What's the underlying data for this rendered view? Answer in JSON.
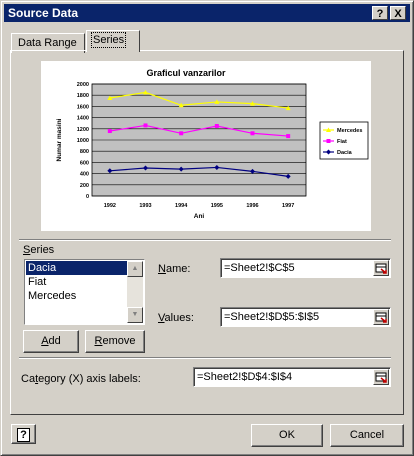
{
  "window": {
    "title": "Source Data",
    "help_glyph": "?",
    "close_glyph": "X"
  },
  "tabs": [
    {
      "label": "Data Range"
    },
    {
      "label": "Series"
    }
  ],
  "chart_data": {
    "type": "line",
    "title": "Graficul vanzarilor",
    "xlabel": "Ani",
    "ylabel": "Numar masini",
    "categories": [
      "1992",
      "1993",
      "1994",
      "1995",
      "1996",
      "1997"
    ],
    "y_ticks": [
      "0",
      "200",
      "400",
      "600",
      "800",
      "1000",
      "1200",
      "1400",
      "1600",
      "1800",
      "2000"
    ],
    "ylim": [
      0,
      2000
    ],
    "grid": true,
    "legend_position": "right",
    "series": [
      {
        "name": "Mercedes",
        "color": "#ffff00",
        "marker": "triangle",
        "values": [
          1750,
          1850,
          1620,
          1680,
          1650,
          1570
        ]
      },
      {
        "name": "Fiat",
        "color": "#ff00ff",
        "marker": "square",
        "values": [
          1160,
          1260,
          1120,
          1250,
          1120,
          1070
        ]
      },
      {
        "name": "Dacia",
        "color": "#000080",
        "marker": "diamond",
        "values": [
          450,
          500,
          480,
          510,
          440,
          350
        ]
      }
    ]
  },
  "series_section": {
    "group_label_pre": "",
    "group_label_key": "S",
    "group_label_post": "eries",
    "items": [
      "Dacia",
      "Fiat",
      "Mercedes"
    ],
    "selected": "Dacia",
    "add": {
      "key": "A",
      "rest": "dd"
    },
    "remove": {
      "key": "R",
      "rest": "emove"
    }
  },
  "fields": {
    "name": {
      "label_key": "N",
      "label_rest": "ame:",
      "value": "=Sheet2!$C$5"
    },
    "values": {
      "label_key": "V",
      "label_rest": "alues:",
      "value": "=Sheet2!$D$5:$I$5"
    },
    "category": {
      "label_pre": "Ca",
      "label_key": "t",
      "label_post": "egory (X) axis labels:",
      "value": "=Sheet2!$D$4:$I$4"
    }
  },
  "footer": {
    "help_icon_glyph": "?",
    "ok_label": "OK",
    "cancel_label": "Cancel"
  }
}
